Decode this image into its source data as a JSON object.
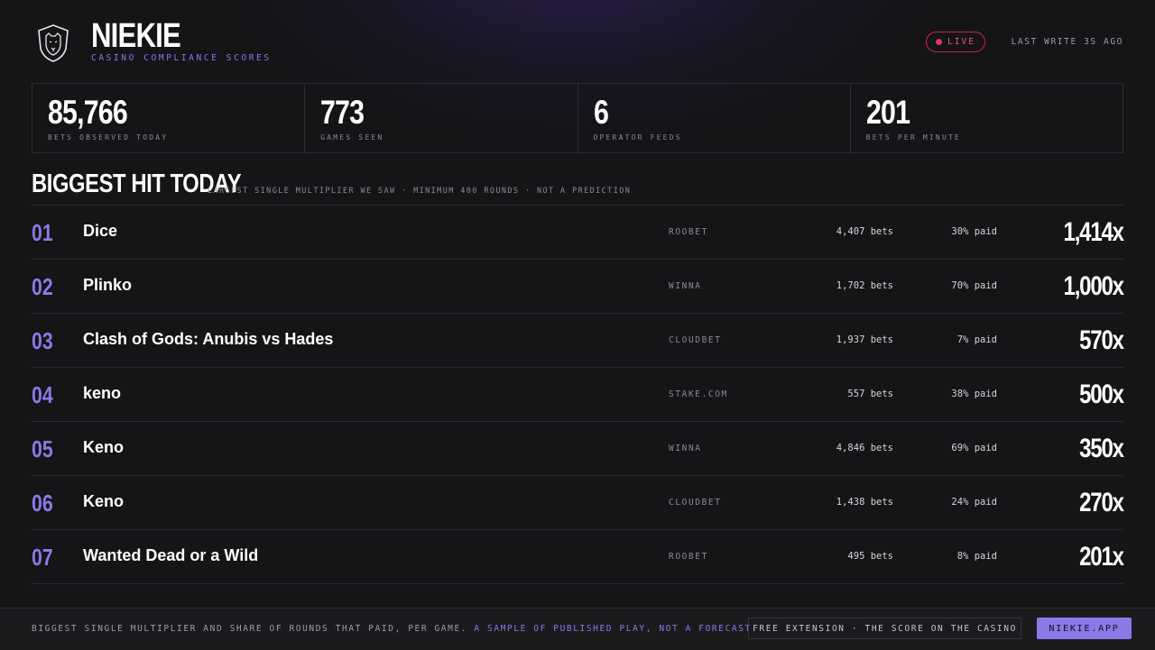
{
  "header": {
    "brand": "NIEKIE",
    "tagline": "CASINO COMPLIANCE SCORES",
    "live_label": "LIVE",
    "last_write": "LAST WRITE 3S AGO"
  },
  "stats": [
    {
      "value": "85,766",
      "label": "BETS OBSERVED TODAY"
    },
    {
      "value": "773",
      "label": "GAMES SEEN"
    },
    {
      "value": "6",
      "label": "OPERATOR FEEDS"
    },
    {
      "value": "201",
      "label": "BETS PER MINUTE"
    }
  ],
  "section": {
    "title": "BIGGEST HIT TODAY",
    "subtitle": "LARGEST SINGLE MULTIPLIER WE SAW · MINIMUM 400 ROUNDS · NOT A PREDICTION"
  },
  "hits": [
    {
      "rank": "01",
      "game": "Dice",
      "operator": "ROOBET",
      "bets": "4,407 bets",
      "paid": "30% paid",
      "multiplier": "1,414x"
    },
    {
      "rank": "02",
      "game": "Plinko",
      "operator": "WINNA",
      "bets": "1,702 bets",
      "paid": "70% paid",
      "multiplier": "1,000x"
    },
    {
      "rank": "03",
      "game": "Clash of Gods: Anubis vs Hades",
      "operator": "CLOUDBET",
      "bets": "1,937 bets",
      "paid": "7% paid",
      "multiplier": "570x"
    },
    {
      "rank": "04",
      "game": "keno",
      "operator": "STAKE.COM",
      "bets": "557 bets",
      "paid": "38% paid",
      "multiplier": "500x"
    },
    {
      "rank": "05",
      "game": "Keno",
      "operator": "WINNA",
      "bets": "4,846 bets",
      "paid": "69% paid",
      "multiplier": "350x"
    },
    {
      "rank": "06",
      "game": "Keno",
      "operator": "CLOUDBET",
      "bets": "1,438 bets",
      "paid": "24% paid",
      "multiplier": "270x"
    },
    {
      "rank": "07",
      "game": "Wanted Dead or a Wild",
      "operator": "ROOBET",
      "bets": "495 bets",
      "paid": "8% paid",
      "multiplier": "201x"
    }
  ],
  "footer": {
    "text": "BIGGEST SINGLE MULTIPLIER AND SHARE OF ROUNDS THAT PAID, PER GAME.",
    "accent": "A SAMPLE OF PUBLISHED PLAY, NOT A FORECAST.",
    "extension": "FREE EXTENSION · THE SCORE ON THE CASINO",
    "cta": "NIEKIE.APP"
  },
  "colors": {
    "accent": "#8b79e6",
    "live": "#e0336a",
    "background": "#151416"
  }
}
